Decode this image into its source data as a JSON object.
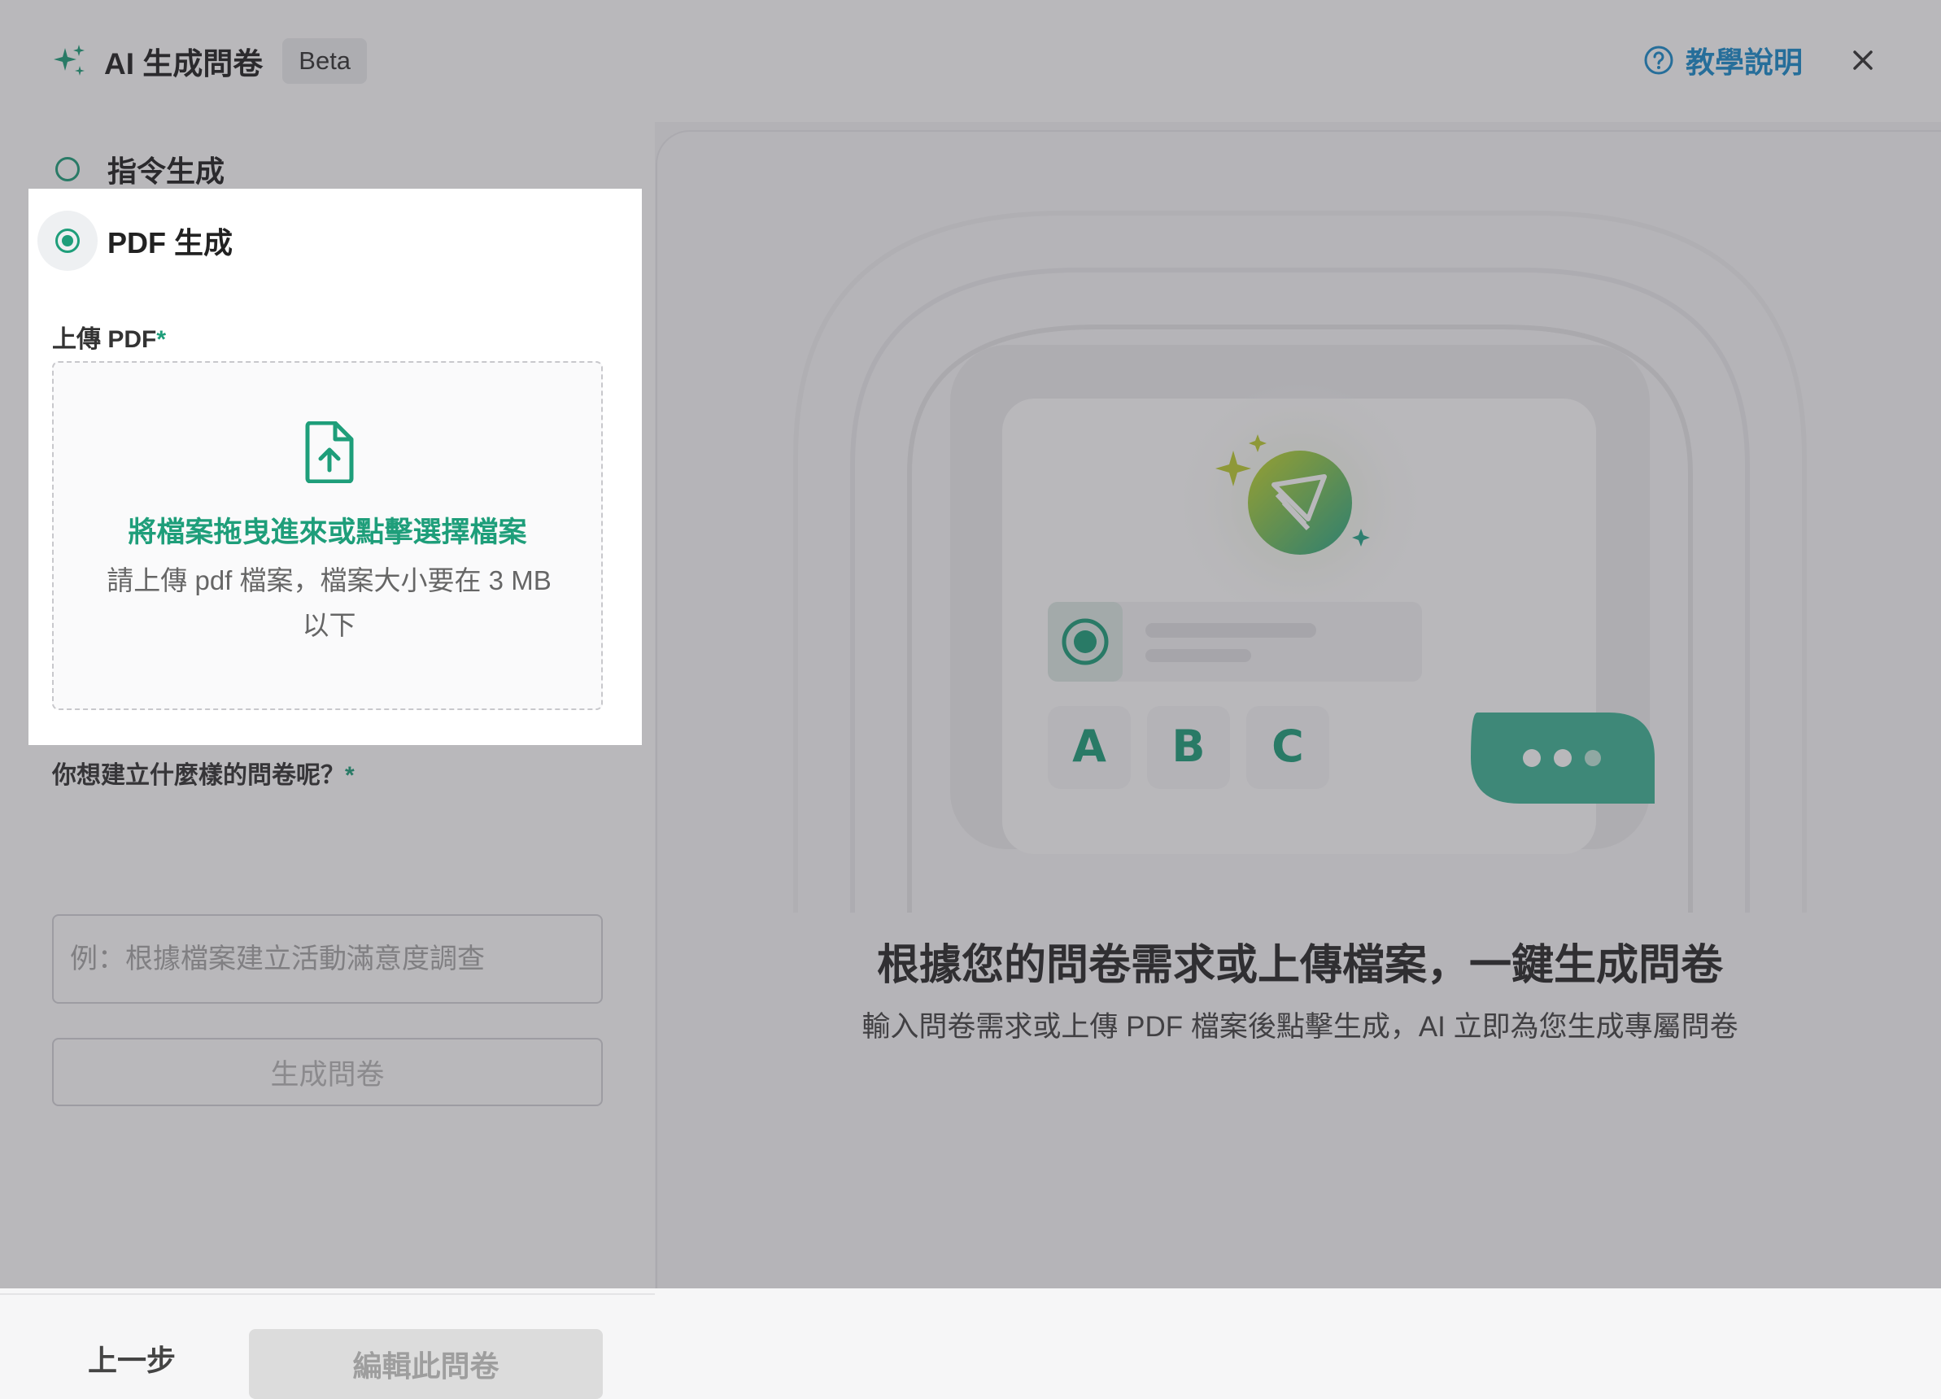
{
  "header": {
    "title": "AI 生成問卷",
    "badge": "Beta",
    "help_label": "教學說明"
  },
  "modes": {
    "instruction_label": "指令生成",
    "pdf_label": "PDF 生成",
    "selected": "pdf"
  },
  "upload": {
    "label": "上傳 PDF",
    "required_mark": "*",
    "dropzone_link": "將檔案拖曳進來或點擊選擇檔案",
    "dropzone_hint": "請上傳 pdf 檔案，檔案大小要在 3 MB 以下"
  },
  "question": {
    "label": "你想建立什麼樣的問卷呢？",
    "required_mark": "*",
    "placeholder": "例：根據檔案建立活動滿意度調查",
    "value": ""
  },
  "actions": {
    "generate": "生成問卷",
    "previous": "上一步",
    "edit": "編輯此問卷"
  },
  "illustration": {
    "options": [
      "A",
      "B",
      "C"
    ]
  },
  "intro": {
    "headline": "根據您的問卷需求或上傳檔案，一鍵生成問卷",
    "subline": "輸入問卷需求或上傳 PDF 檔案後點擊生成，AI 立即為您生成專屬問卷"
  },
  "colors": {
    "accent": "#1e9e7a",
    "link": "#1a8ccc",
    "overlay": "rgba(60,58,66,0.36)"
  }
}
